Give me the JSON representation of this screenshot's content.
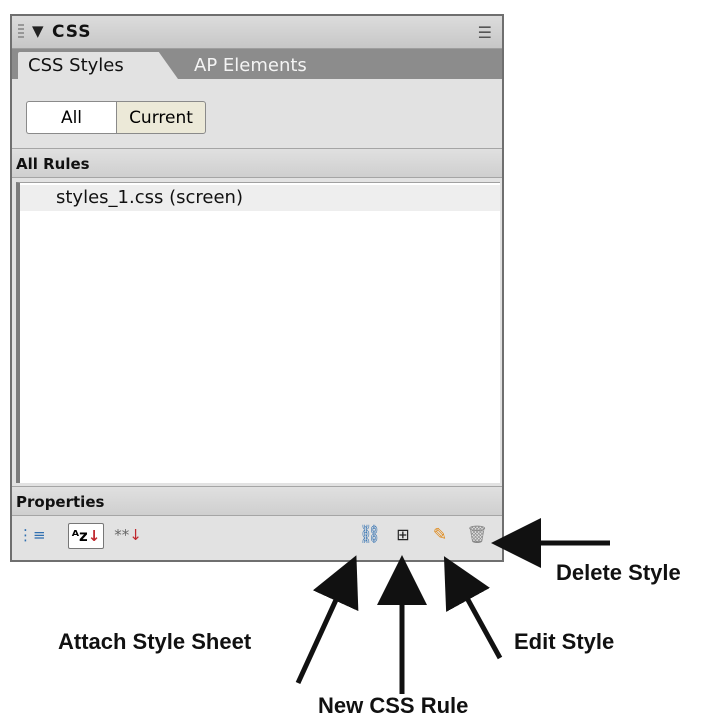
{
  "panel": {
    "title": "CSS",
    "collapse_arrow": "▼",
    "menu_icon": "panel-options-icon"
  },
  "tabs": [
    {
      "label": "CSS Styles",
      "active": true
    },
    {
      "label": "AP Elements",
      "active": false
    }
  ],
  "mode": {
    "all_label": "All",
    "current_label": "Current",
    "selected": "All"
  },
  "rules": {
    "header": "All Rules",
    "items": [
      "styles_1.css (screen)"
    ]
  },
  "properties": {
    "header": "Properties"
  },
  "toolbar": {
    "az_text": "ᴬz",
    "az_arrow": "↓",
    "set_text": "**",
    "set_arrow": "↓"
  },
  "callouts": {
    "delete": "Delete Style",
    "attach": "Attach Style Sheet",
    "edit": "Edit Style",
    "new_rule": "New CSS Rule"
  },
  "colors": {
    "panel_bg": "#e2e2e2",
    "tab_strip": "#8c8c8c",
    "accent_red": "#c0272d",
    "accent_blue": "#2f6fb0"
  }
}
